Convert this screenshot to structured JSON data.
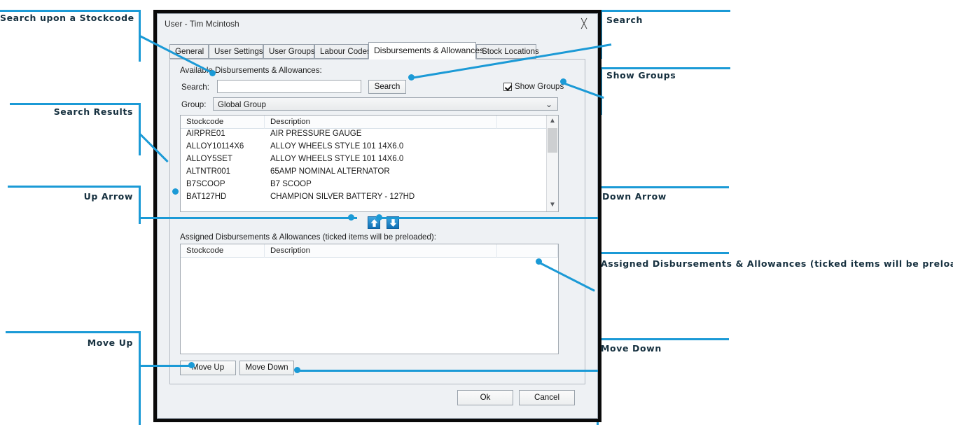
{
  "window": {
    "title": "User - Tim Mcintosh",
    "close_icon": "close-x-icon"
  },
  "tabs": [
    {
      "label": "General",
      "active": false
    },
    {
      "label": "User Settings",
      "active": false
    },
    {
      "label": "User Groups",
      "active": false
    },
    {
      "label": "Labour Codes",
      "active": false
    },
    {
      "label": "Disbursements & Allowances",
      "active": true
    },
    {
      "label": "Stock Locations",
      "active": false
    }
  ],
  "available": {
    "section_label": "Available Disbursements & Allowances:",
    "search_label": "Search:",
    "search_value": "",
    "search_placeholder": "",
    "search_button": "Search",
    "show_groups_label": "Show Groups",
    "show_groups_checked": true,
    "group_label": "Group:",
    "group_value": "Global Group",
    "group_options": [
      "Global Group"
    ],
    "columns": [
      "Stockcode",
      "Description"
    ],
    "rows": [
      {
        "stockcode": "AIRPRE01",
        "description": "AIR PRESSURE GAUGE"
      },
      {
        "stockcode": "ALLOY10114X6",
        "description": "ALLOY WHEELS STYLE 101 14X6.0"
      },
      {
        "stockcode": "ALLOY5SET",
        "description": "ALLOY WHEELS STYLE 101 14X6.0"
      },
      {
        "stockcode": "ALTNTR001",
        "description": "65AMP NOMINAL ALTERNATOR"
      },
      {
        "stockcode": "B7SCOOP",
        "description": "B7 SCOOP"
      },
      {
        "stockcode": "BAT127HD",
        "description": "CHAMPION SILVER BATTERY  - 127HD"
      }
    ],
    "scroll_up_icon": "chevron-up-icon",
    "scroll_down_icon": "chevron-down-icon"
  },
  "transfer": {
    "up_icon": "arrow-up-icon",
    "down_icon": "arrow-down-icon"
  },
  "assigned": {
    "section_label": "Assigned Disbursements & Allowances (ticked items will be preloaded):",
    "columns": [
      "Stockcode",
      "Description"
    ],
    "rows": [],
    "move_up_button": "Move Up",
    "move_down_button": "Move Down"
  },
  "footer": {
    "ok_button": "Ok",
    "cancel_button": "Cancel"
  },
  "annotations": {
    "accent_color": "#1b9ad6",
    "text_color": "#16303f",
    "left": [
      {
        "text": "Search upon a Stockcode"
      },
      {
        "text": "Search Results"
      },
      {
        "text": "Up Arrow"
      },
      {
        "text": "Move Up"
      }
    ],
    "right": [
      {
        "text": "Search"
      },
      {
        "text": "Show Groups"
      },
      {
        "text": "Down Arrow"
      },
      {
        "text": "Assigned Disbursements & Allowances (ticked items will be preloaded)"
      },
      {
        "text": "Move Down"
      }
    ]
  }
}
